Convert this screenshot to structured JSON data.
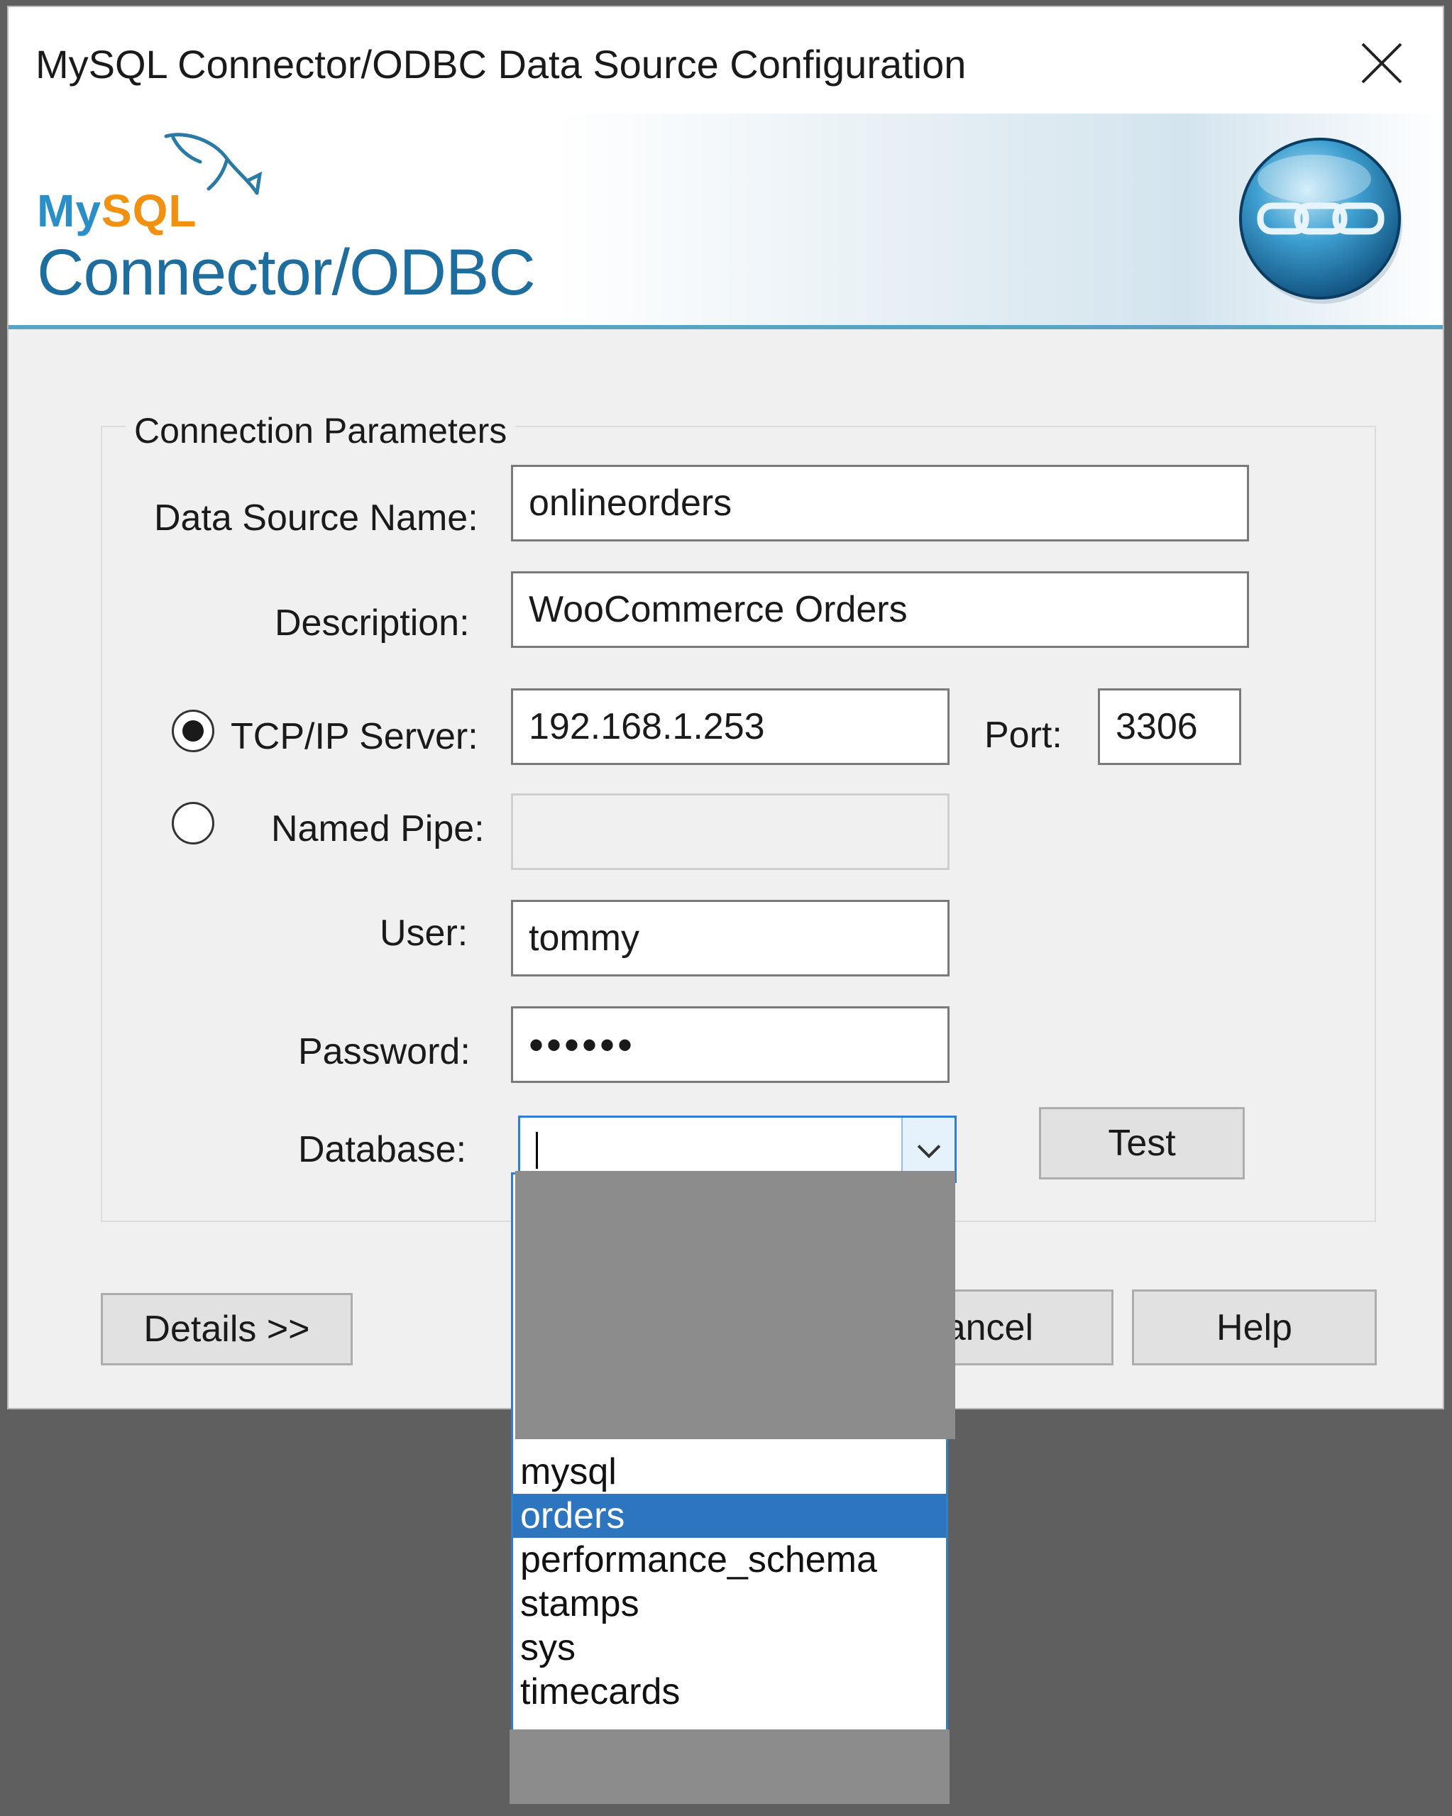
{
  "window": {
    "title": "MySQL Connector/ODBC Data Source Configuration"
  },
  "banner": {
    "logo_my": "My",
    "logo_sql": "SQL",
    "product": "Connector/ODBC",
    "badge_icon": "chain-link-icon"
  },
  "group": {
    "legend": "Connection Parameters"
  },
  "form": {
    "dsn_label": "Data Source Name:",
    "dsn_value": "onlineorders",
    "description_label": "Description:",
    "description_value": "WooCommerce Orders",
    "tcp_label": "TCP/IP Server:",
    "tcp_selected": true,
    "server_value": "192.168.1.253",
    "port_label": "Port:",
    "port_value": "3306",
    "pipe_label": "Named Pipe:",
    "pipe_value": "",
    "user_label": "User:",
    "user_value": "tommy",
    "password_label": "Password:",
    "password_value": "••••••",
    "database_label": "Database:",
    "database_value": ""
  },
  "buttons": {
    "test": "Test",
    "details": "Details >>",
    "cancel_partial": "ancel",
    "help": "Help"
  },
  "dropdown": {
    "items": [
      "mysql",
      "orders",
      "performance_schema",
      "stamps",
      "sys",
      "timecards"
    ],
    "selected": "orders"
  },
  "colors": {
    "accent": "#2e7fce",
    "selection": "#2e75c0",
    "redaction": "#8c8c8c",
    "backdrop": "#5f5f5f"
  }
}
